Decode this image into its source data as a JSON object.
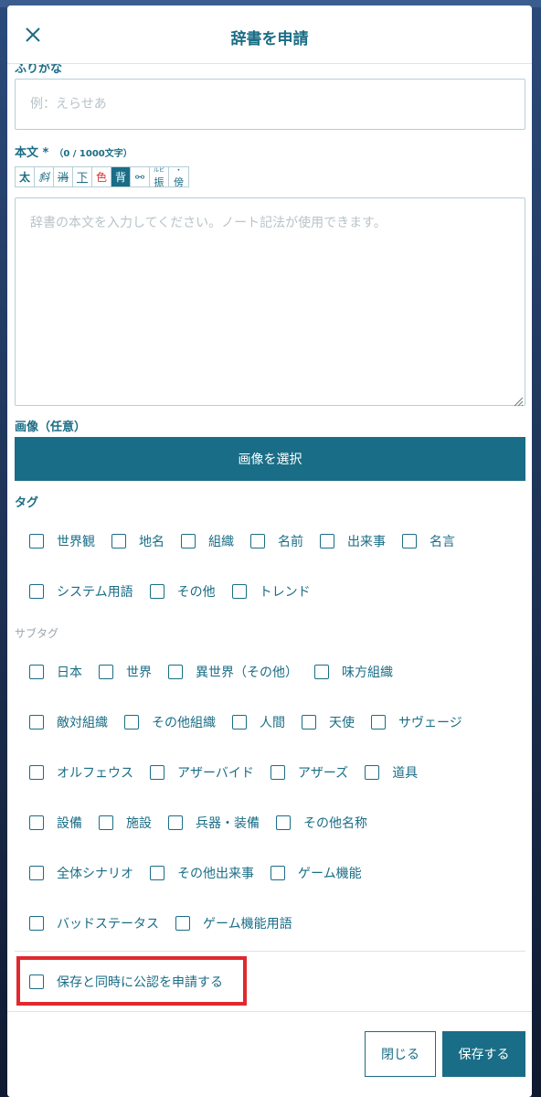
{
  "header": {
    "title": "辞書を申請"
  },
  "form": {
    "partial_label": "ふりがな",
    "reading_placeholder": "例：えらせあ",
    "body_label": "本文 *",
    "body_count": "（0 / 1000文字）",
    "toolbar": [
      {
        "icon": "bold",
        "label": "太"
      },
      {
        "icon": "italic",
        "label": "斜"
      },
      {
        "icon": "strike",
        "label": "消"
      },
      {
        "icon": "underline",
        "label": "下"
      },
      {
        "icon": "color",
        "label": "色"
      },
      {
        "icon": "background",
        "label": "背"
      },
      {
        "icon": "link",
        "label": "⚯"
      },
      {
        "icon": "ruby",
        "top": "ルビ",
        "label": "振"
      },
      {
        "icon": "emphasis",
        "top": "•",
        "label": "傍"
      }
    ],
    "body_placeholder": "辞書の本文を入力してください。ノート記法が使用できます。",
    "image_label": "画像（任意）",
    "select_image_label": "画像を選択",
    "tag_label": "タグ",
    "tags": [
      [
        "世界観",
        "地名",
        "組織",
        "名前",
        "出来事",
        "名言"
      ],
      [
        "システム用語",
        "その他",
        "トレンド"
      ]
    ],
    "subtag_label": "サブタグ",
    "subtags": [
      [
        "日本",
        "世界",
        "異世界（その他）",
        "味方組織"
      ],
      [
        "敵対組織",
        "その他組織",
        "人間",
        "天使",
        "サヴェージ"
      ],
      [
        "オルフェウス",
        "アザーバイド",
        "アザーズ",
        "道具"
      ],
      [
        "設備",
        "施設",
        "兵器・装備",
        "その他名称"
      ],
      [
        "全体シナリオ",
        "その他出来事",
        "ゲーム機能"
      ],
      [
        "バッドステータス",
        "ゲーム機能用語"
      ]
    ],
    "apply_official_label": "保存と同時に公認を申請する"
  },
  "footer": {
    "close_label": "閉じる",
    "save_label": "保存する"
  },
  "colors": {
    "accent": "#1a6d86",
    "highlight": "#e0282e"
  }
}
